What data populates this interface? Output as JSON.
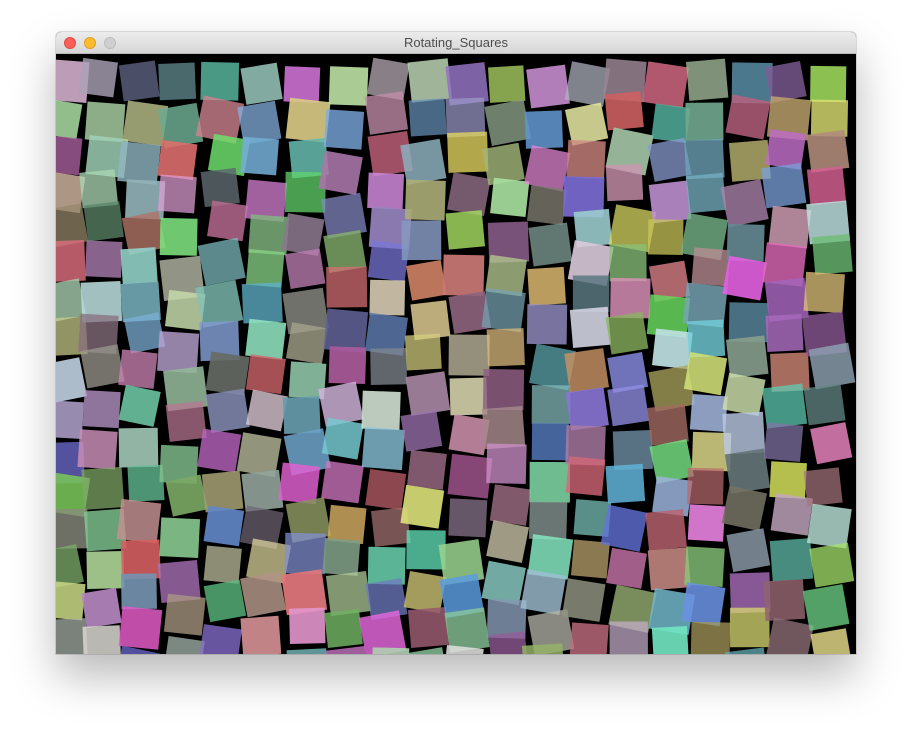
{
  "window": {
    "title": "Rotating_Squares"
  },
  "canvas": {
    "background_color": "#000000",
    "content": "grid of semi-transparent rotated colored squares"
  },
  "traffic_lights": {
    "close_color": "#fc5f57",
    "minimize_color": "#fdbc2e",
    "zoom_color": "#cfcfcf"
  }
}
